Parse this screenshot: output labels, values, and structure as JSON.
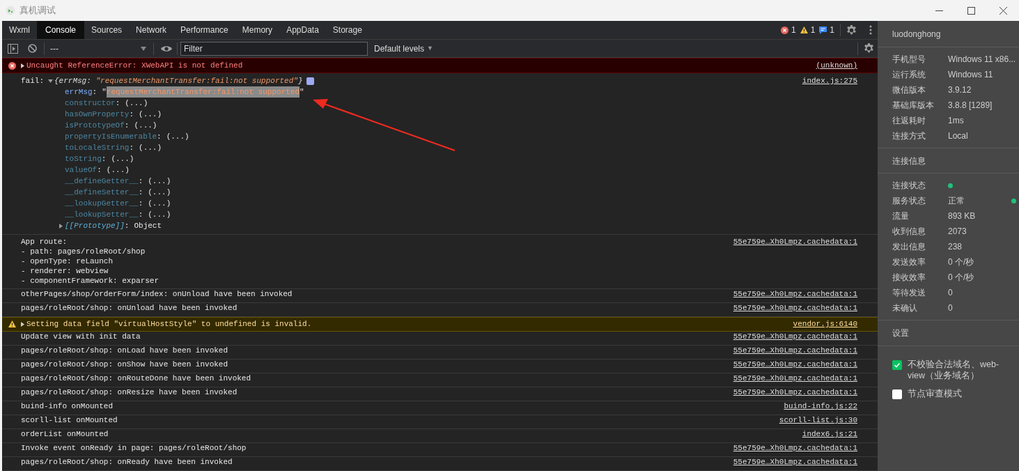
{
  "window": {
    "title": "真机调试"
  },
  "tabs": [
    {
      "label": "Wxml",
      "selected": false
    },
    {
      "label": "Console",
      "selected": true
    },
    {
      "label": "Sources",
      "selected": false
    },
    {
      "label": "Network",
      "selected": false
    },
    {
      "label": "Performance",
      "selected": false
    },
    {
      "label": "Memory",
      "selected": false
    },
    {
      "label": "AppData",
      "selected": false
    },
    {
      "label": "Storage",
      "selected": false
    }
  ],
  "counts": [
    {
      "kind": "error",
      "count": "1"
    },
    {
      "kind": "warning",
      "count": "1"
    },
    {
      "kind": "info",
      "count": "1"
    }
  ],
  "toolbar": {
    "context": "---",
    "filter": {
      "placeholder": "Filter"
    },
    "levels": "Default levels",
    "levels_caret": "▼"
  },
  "messages": [
    {
      "kind": "error",
      "expanded": false,
      "text": "Uncaught ReferenceError: XWebAPI is not defined",
      "source": "(unknown)"
    },
    {
      "kind": "object",
      "expanded": true,
      "label": "fail:",
      "summary_key": "{errMsg:",
      "summary_value": "\"requestMerchantTransfer:fail:not supported\"",
      "summary_close": "}",
      "source": "index.js:275",
      "properties": [
        {
          "kind": "own",
          "key": "errMsg",
          "colon": ":",
          "open_quote": "\"",
          "value": "requestMerchantTransfer:fail:not supported",
          "close_quote": "\"",
          "selected": true
        },
        {
          "kind": "inherited",
          "key": "constructor",
          "colon": ":",
          "value": "(...)",
          "selected": false
        },
        {
          "kind": "inherited",
          "key": "hasOwnProperty",
          "colon": ":",
          "value": "(...)",
          "selected": false
        },
        {
          "kind": "inherited",
          "key": "isPrototypeOf",
          "colon": ":",
          "value": "(...)",
          "selected": false
        },
        {
          "kind": "inherited",
          "key": "propertyIsEnumerable",
          "colon": ":",
          "value": "(...)",
          "selected": false
        },
        {
          "kind": "inherited",
          "key": "toLocaleString",
          "colon": ":",
          "value": "(...)",
          "selected": false
        },
        {
          "kind": "inherited",
          "key": "toString",
          "colon": ":",
          "value": "(...)",
          "selected": false
        },
        {
          "kind": "inherited",
          "key": "valueOf",
          "colon": ":",
          "value": "(...)",
          "selected": false
        },
        {
          "kind": "inherited",
          "key": "__defineGetter__",
          "colon": ":",
          "value": "(...)",
          "selected": false
        },
        {
          "kind": "inherited",
          "key": "__defineSetter__",
          "colon": ":",
          "value": "(...)",
          "selected": false
        },
        {
          "kind": "inherited",
          "key": "__lookupGetter__",
          "colon": ":",
          "value": "(...)",
          "selected": false
        },
        {
          "kind": "inherited",
          "key": "__lookupSetter__",
          "colon": ":",
          "value": "(...)",
          "selected": false
        }
      ],
      "prototype": {
        "key": "[[Prototype]]",
        "colon": ":",
        "value": "Object",
        "expanded": false
      }
    },
    {
      "kind": "log",
      "lines": [
        "App route:",
        "- path: pages/roleRoot/shop",
        "- openType: reLaunch",
        "- renderer: webview",
        "- componentFramework: exparser"
      ],
      "source": "55e759e…Xh0Lmpz.cachedata:1"
    },
    {
      "kind": "log",
      "lines": [
        "otherPages/shop/orderForm/index: onUnload have been invoked"
      ],
      "source": "55e759e…Xh0Lmpz.cachedata:1"
    },
    {
      "kind": "log",
      "lines": [
        "pages/roleRoot/shop: onUnload have been invoked"
      ],
      "source": "55e759e…Xh0Lmpz.cachedata:1"
    },
    {
      "kind": "warning",
      "expanded": false,
      "text": "Setting data field \"virtualHostStyle\" to undefined is invalid.",
      "source": "vendor.js:6140"
    },
    {
      "kind": "log",
      "lines": [
        "Update view with init data"
      ],
      "source": "55e759e…Xh0Lmpz.cachedata:1"
    },
    {
      "kind": "log",
      "lines": [
        "pages/roleRoot/shop: onLoad have been invoked"
      ],
      "source": "55e759e…Xh0Lmpz.cachedata:1"
    },
    {
      "kind": "log",
      "lines": [
        "pages/roleRoot/shop: onShow have been invoked"
      ],
      "source": "55e759e…Xh0Lmpz.cachedata:1"
    },
    {
      "kind": "log",
      "lines": [
        "pages/roleRoot/shop: onRouteDone have been invoked"
      ],
      "source": "55e759e…Xh0Lmpz.cachedata:1"
    },
    {
      "kind": "log",
      "lines": [
        "pages/roleRoot/shop: onResize have been invoked"
      ],
      "source": "55e759e…Xh0Lmpz.cachedata:1"
    },
    {
      "kind": "log",
      "lines": [
        "buind-info onMounted"
      ],
      "source": "buind-info.js:22"
    },
    {
      "kind": "log",
      "lines": [
        "scorll-list onMounted"
      ],
      "source": "scorll-list.js:30"
    },
    {
      "kind": "log",
      "lines": [
        "orderList onMounted"
      ],
      "source": "index6.js:21"
    },
    {
      "kind": "log",
      "lines": [
        "Invoke event onReady in page: pages/roleRoot/shop"
      ],
      "source": "55e759e…Xh0Lmpz.cachedata:1"
    },
    {
      "kind": "log",
      "lines": [
        "pages/roleRoot/shop: onReady have been invoked"
      ],
      "source": "55e759e…Xh0Lmpz.cachedata:1"
    }
  ],
  "sidebar": {
    "user": "luodonghong",
    "device_info": [
      {
        "label": "手机型号",
        "value": "Windows 11 x86..."
      },
      {
        "label": "运行系统",
        "value": "Windows 11"
      },
      {
        "label": "微信版本",
        "value": "3.9.12"
      },
      {
        "label": "基础库版本",
        "value": "3.8.8 [1289]"
      },
      {
        "label": "往返耗时",
        "value": "1ms"
      },
      {
        "label": "连接方式",
        "value": "Local"
      }
    ],
    "connection_title": "连接信息",
    "connection_info": [
      {
        "kind": "dot",
        "label": "连接状态",
        "color": "#1ec27a"
      },
      {
        "kind": "text_dot",
        "label": "服务状态",
        "value": "正常",
        "color": "#1ec27a"
      },
      {
        "kind": "text",
        "label": "流量",
        "value": "893 KB"
      },
      {
        "kind": "text",
        "label": "收到信息",
        "value": "2073"
      },
      {
        "kind": "text",
        "label": "发出信息",
        "value": "238"
      },
      {
        "kind": "text",
        "label": "发送效率",
        "value": "0 个/秒"
      },
      {
        "kind": "text",
        "label": "接收效率",
        "value": "0 个/秒"
      },
      {
        "kind": "text",
        "label": "等待发送",
        "value": "0"
      },
      {
        "kind": "text",
        "label": "未确认",
        "value": "0"
      }
    ],
    "settings_title": "设置",
    "settings": [
      {
        "label": "不校验合法域名、web-view（业务域名）",
        "checked": true
      },
      {
        "label": "节点审查模式",
        "checked": false
      }
    ]
  }
}
